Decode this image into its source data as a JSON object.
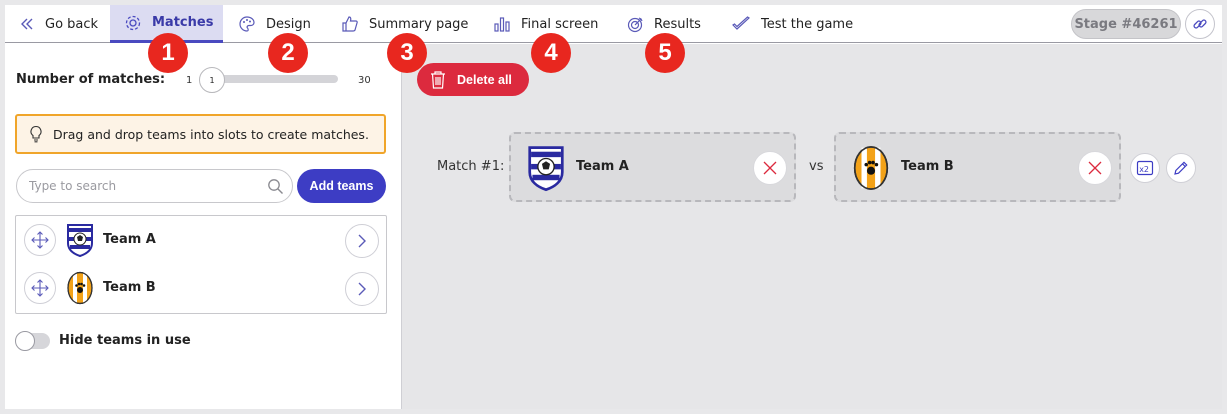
{
  "nav": {
    "back_label": "Go back",
    "tabs": [
      {
        "label": "Matches",
        "icon": "gear-icon"
      },
      {
        "label": "Design",
        "icon": "palette-icon"
      },
      {
        "label": "Summary page",
        "icon": "thumbs-up-icon"
      },
      {
        "label": "Final screen",
        "icon": "bar-chart-icon"
      },
      {
        "label": "Results",
        "icon": "target-icon"
      },
      {
        "label": "Test the game",
        "icon": "check-icon"
      }
    ],
    "stage_label": "Stage #46261",
    "accent_color": "#3d3dc4"
  },
  "badges": [
    "1",
    "2",
    "3",
    "4",
    "5"
  ],
  "left_panel": {
    "matches_label": "Number of matches:",
    "slider_min": "1",
    "slider_value": "1",
    "slider_max": "30",
    "hint_text": "Drag and drop teams into slots to create matches.",
    "search_placeholder": "Type to search",
    "add_teams_label": "Add teams",
    "teams": [
      {
        "name": "Team A",
        "logo": "shield-logo-blue"
      },
      {
        "name": "Team B",
        "logo": "shield-logo-orange-paw"
      }
    ],
    "hide_toggle_label": "Hide teams in use",
    "hide_toggle_on": false
  },
  "right_panel": {
    "delete_all_label": "Delete all",
    "delete_color": "#dc2a3e",
    "match": {
      "label": "Match #1:",
      "team_a": "Team A",
      "vs_label": "vs",
      "team_b": "Team B",
      "multiplier_label": "x2"
    }
  }
}
